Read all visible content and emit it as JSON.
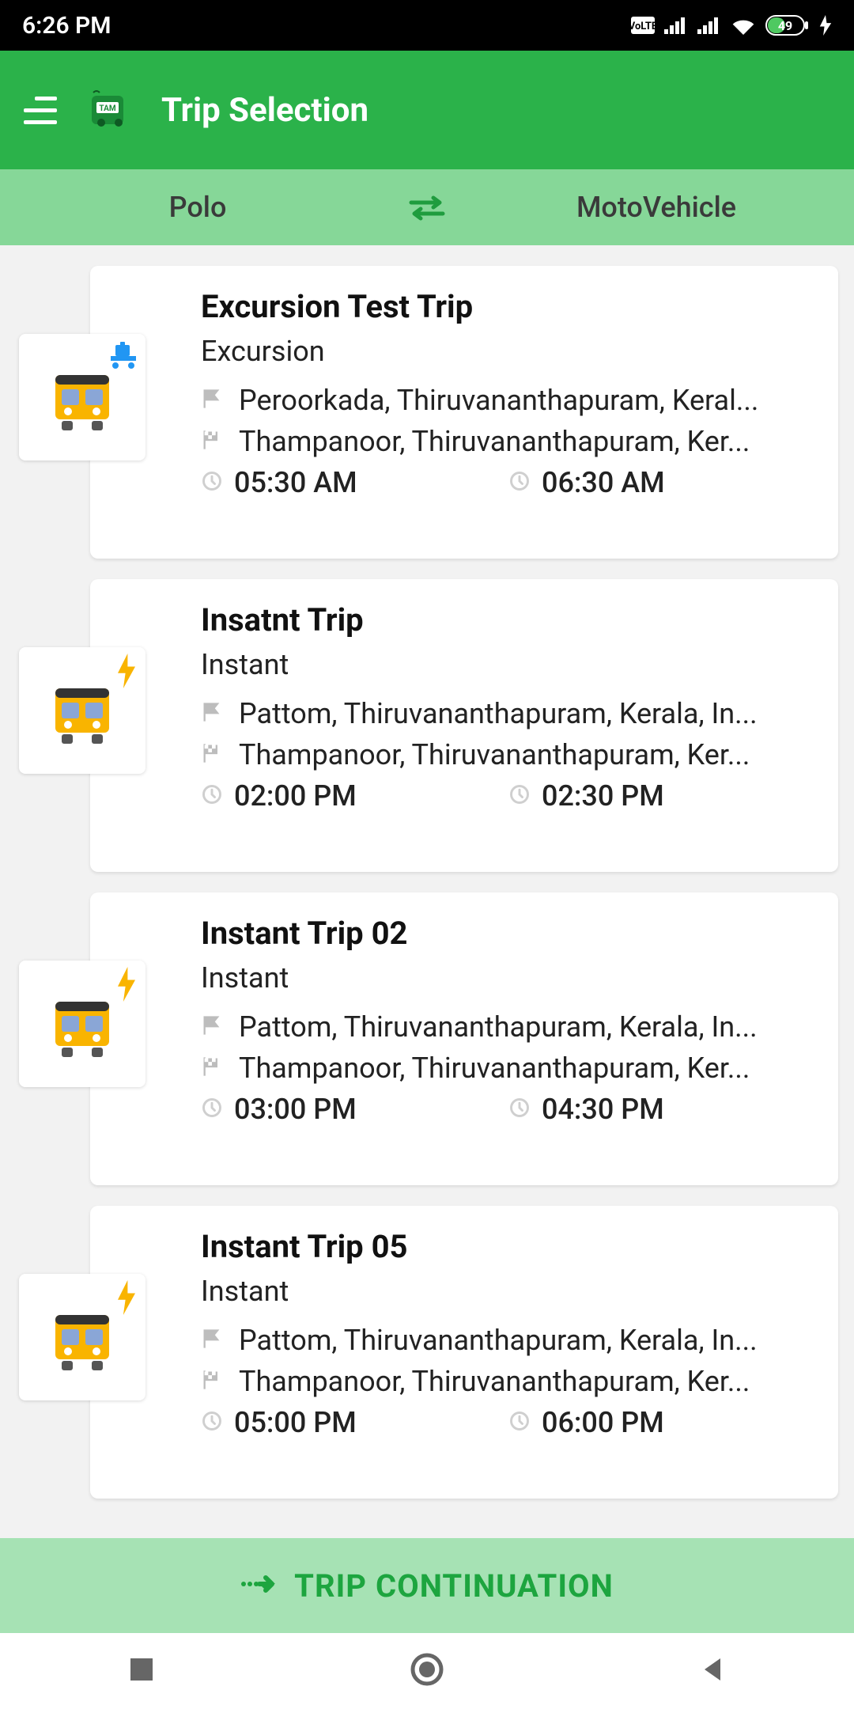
{
  "status": {
    "time": "6:26 PM",
    "battery": "49"
  },
  "app_bar": {
    "title": "Trip Selection"
  },
  "sub_bar": {
    "left": "Polo",
    "right": "MotoVehicle"
  },
  "trips": [
    {
      "title": "Excursion Test Trip",
      "type": "Excursion",
      "from": "Peroorkada, Thiruvananthapuram, Keral...",
      "to": "Thampanoor, Thiruvananthapuram, Ker...",
      "t1": "05:30 AM",
      "t2": "06:30 AM",
      "badge_overlay": "luggage"
    },
    {
      "title": "Insatnt Trip",
      "type": "Instant",
      "from": "Pattom, Thiruvananthapuram, Kerala, In...",
      "to": "Thampanoor, Thiruvananthapuram, Ker...",
      "t1": "02:00 PM",
      "t2": "02:30 PM",
      "badge_overlay": "bolt"
    },
    {
      "title": "Instant Trip 02",
      "type": "Instant",
      "from": "Pattom, Thiruvananthapuram, Kerala, In...",
      "to": "Thampanoor, Thiruvananthapuram, Ker...",
      "t1": "03:00 PM",
      "t2": "04:30 PM",
      "badge_overlay": "bolt"
    },
    {
      "title": "Instant Trip 05",
      "type": "Instant",
      "from": "Pattom, Thiruvananthapuram, Kerala, In...",
      "to": "Thampanoor, Thiruvananthapuram, Ker...",
      "t1": "05:00 PM",
      "t2": "06:00 PM",
      "badge_overlay": "bolt"
    }
  ],
  "continuation": {
    "label": "TRIP CONTINUATION"
  }
}
